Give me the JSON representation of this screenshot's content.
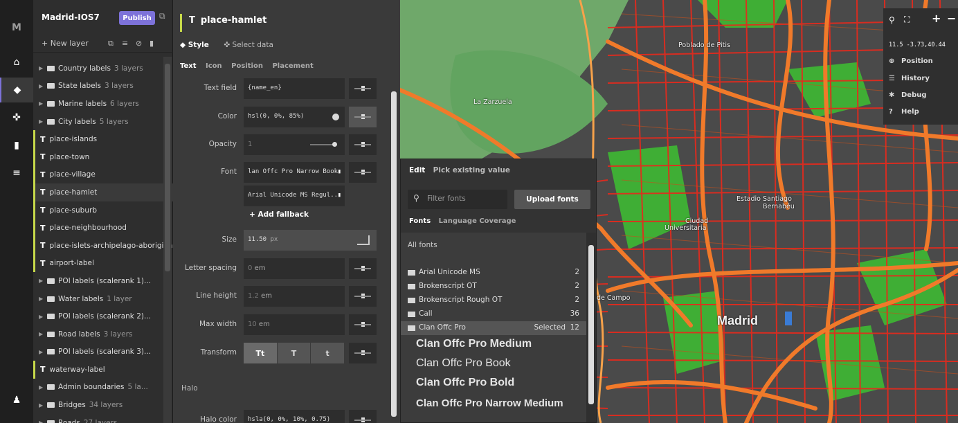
{
  "rail": {
    "logo": "M",
    "colors": {
      "accent": "#7d72d9",
      "selected_layer": "#c7d94a"
    }
  },
  "layers_panel": {
    "style_name": "Madrid-IOS7",
    "publish_label": "Publish",
    "new_layer_label": "+ New layer",
    "items": [
      {
        "type": "group",
        "label": "Country labels",
        "count": "3 layers"
      },
      {
        "type": "group",
        "label": "State labels",
        "count": "3 layers"
      },
      {
        "type": "group",
        "label": "Marine labels",
        "count": "6 layers"
      },
      {
        "type": "group",
        "label": "City labels",
        "count": "5 layers"
      },
      {
        "type": "symbol",
        "label": "place-islands"
      },
      {
        "type": "symbol",
        "label": "place-town"
      },
      {
        "type": "symbol",
        "label": "place-village"
      },
      {
        "type": "symbol",
        "label": "place-hamlet",
        "selected": true
      },
      {
        "type": "symbol",
        "label": "place-suburb"
      },
      {
        "type": "symbol",
        "label": "place-neighbourhood"
      },
      {
        "type": "symbol",
        "label": "place-islets-archipelago-aboriginal"
      },
      {
        "type": "symbol",
        "label": "airport-label"
      },
      {
        "type": "group",
        "label": "POI labels (scalerank 1)...",
        "count": ""
      },
      {
        "type": "group",
        "label": "Water labels",
        "count": "1 layer"
      },
      {
        "type": "group",
        "label": "POI labels (scalerank 2)...",
        "count": ""
      },
      {
        "type": "group",
        "label": "Road labels",
        "count": "3 layers"
      },
      {
        "type": "group",
        "label": "POI labels (scalerank 3)...",
        "count": ""
      },
      {
        "type": "symbol",
        "label": "waterway-label"
      },
      {
        "type": "group",
        "label": "Admin boundaries",
        "count": "5 la..."
      },
      {
        "type": "group",
        "label": "Bridges",
        "count": "34 layers"
      },
      {
        "type": "group",
        "label": "Roads",
        "count": "27 layers"
      }
    ]
  },
  "props_panel": {
    "layer_title": "place-hamlet",
    "main_tabs": [
      "Style",
      "Select data"
    ],
    "sub_tabs": [
      "Text",
      "Icon",
      "Position",
      "Placement"
    ],
    "rows": {
      "text_field": {
        "label": "Text field",
        "value": "{name_en}"
      },
      "color": {
        "label": "Color",
        "value": "hsl(0, 0%, 85%)"
      },
      "opacity": {
        "label": "Opacity",
        "value": "1"
      },
      "font": {
        "label": "Font",
        "value": "lan Offc Pro Narrow Book",
        "fallback": "Arial Unicode MS Regul..."
      },
      "add_fallback": "+ Add fallback",
      "size": {
        "label": "Size",
        "value": "11.50",
        "unit": "px"
      },
      "letter_spacing": {
        "label": "Letter spacing",
        "value": "0",
        "unit": "em"
      },
      "line_height": {
        "label": "Line height",
        "value": "1.2",
        "unit": "em"
      },
      "max_width": {
        "label": "Max width",
        "value": "10",
        "unit": "em"
      },
      "transform": {
        "label": "Transform",
        "options": [
          "Tt",
          "T",
          "t"
        ]
      }
    },
    "halo_section": "Halo",
    "halo_color": {
      "label": "Halo color",
      "value": "hsla(0, 0%, 10%, 0.75)"
    }
  },
  "font_picker": {
    "tabs": [
      "Edit",
      "Pick existing value"
    ],
    "filter_placeholder": "Filter fonts",
    "upload_label": "Upload fonts",
    "sub_tabs": [
      "Fonts",
      "Language Coverage"
    ],
    "all_fonts_label": "All fonts",
    "fonts": [
      {
        "name": "Arial Unicode MS",
        "count": "2"
      },
      {
        "name": "Brokenscript OT",
        "count": "2"
      },
      {
        "name": "Brokenscript Rough OT",
        "count": "2"
      },
      {
        "name": "Call",
        "count": "36"
      },
      {
        "name": "Clan Offc Pro",
        "count": "12",
        "selected_label": "Selected"
      }
    ],
    "samples": [
      "Clan Offc Pro Medium",
      "Clan Offc Pro Book",
      "Clan Offc Pro Bold",
      "Clan Offc Pro Narrow Medium"
    ]
  },
  "map": {
    "labels": {
      "poblado": "Poblado de Pitis",
      "zarzuela": "La Zarzuela",
      "ciudad": "Ciudad",
      "universitaria": "Universitaria",
      "santiago": "Estadio Santiago",
      "bernabeu": "Bernabéu",
      "campo": "de Campo",
      "madrid": "Madrid"
    },
    "colors": {
      "road": "#e8291c",
      "arterial": "#f07a2a",
      "park": "#3fae35",
      "wood": "#6fa86a",
      "ground": "#4a4a4a"
    }
  },
  "map_controls": {
    "coords": "11.5 -3.73,40.44",
    "items": [
      "Position",
      "History",
      "Debug",
      "Help"
    ]
  }
}
